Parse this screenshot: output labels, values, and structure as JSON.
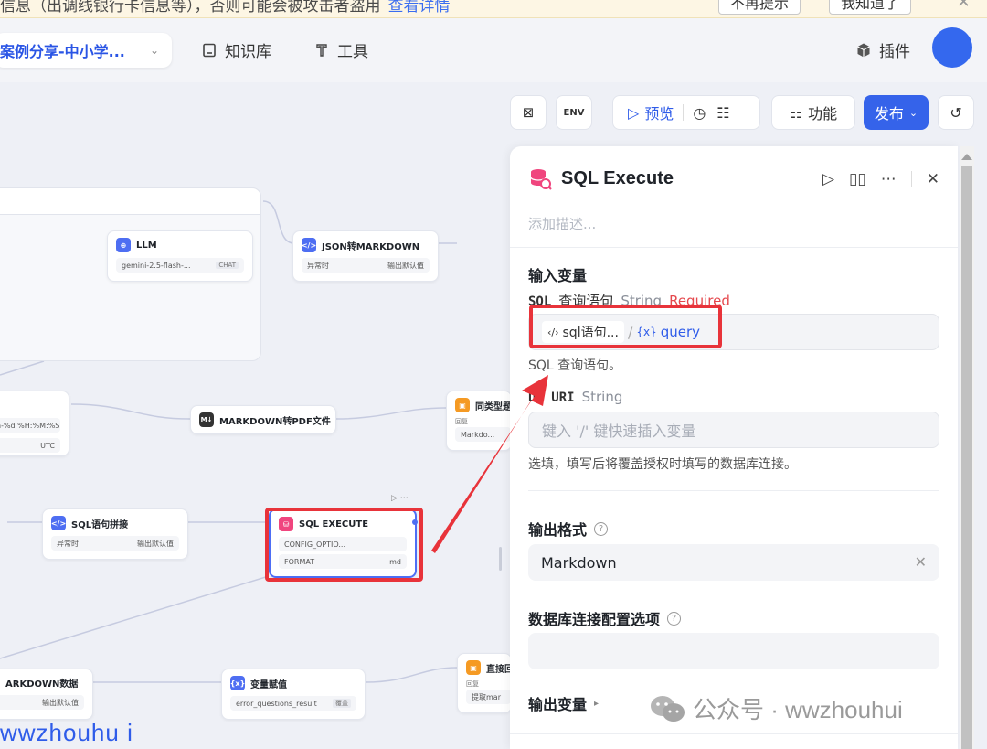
{
  "notice": {
    "text": "信息（出调线银行卡信息等），否则可能会被攻击者盗用",
    "link": "查看详情",
    "btn_nomore": "不再提示",
    "btn_ok": "我知道了",
    "close": "✕"
  },
  "nav": {
    "app_name": "案例分享-中小学...",
    "knowledge": "知识库",
    "tools": "工具",
    "plugins": "插件"
  },
  "toolbar": {
    "preview": "预览",
    "features": "功能",
    "publish": "发布"
  },
  "nodes": {
    "llm": {
      "title": "LLM",
      "model": "gemini-2.5-flash-...",
      "tag": "CHAT"
    },
    "json_md": {
      "title": "JSON转MARKDOWN",
      "label_left": "异常时",
      "label_right": "输出默认值"
    },
    "time": {
      "format": "n-%d %H:%M:%S",
      "tz": "UTC"
    },
    "md_pdf": {
      "title": "MARKDOWN转PDF文件",
      "badge": "M↓"
    },
    "similar": {
      "title": "同类型题目",
      "sub": "回复",
      "row": "Markdo..."
    },
    "sql_concat": {
      "title": "SQL语句拼接",
      "label_left": "异常时",
      "label_right": "输出默认值"
    },
    "sql_exec": {
      "title": "SQL EXECUTE",
      "row1": "CONFIG_OPTIO...",
      "row2_left": "FORMAT",
      "row2_right": "md"
    },
    "md_data": {
      "title": "ARKDOWN数据",
      "label_right": "输出默认值"
    },
    "assign": {
      "title": "变量赋值",
      "row": "error_questions_result",
      "tag": "覆盖"
    },
    "direct_reply": {
      "title": "直接回复",
      "sub": "回复",
      "row": "提取mar"
    }
  },
  "panel": {
    "title": "SQL Execute",
    "desc_placeholder": "添加描述...",
    "input_section": "输入变量",
    "sql_var": {
      "code": "SQL",
      "name": "查询语句",
      "type": "String",
      "required": "Required"
    },
    "sql_chip": "sql语句...",
    "sql_chip_sep": "/",
    "sql_var_ref": "query",
    "sql_hint": "SQL 查询语句。",
    "uri_var": {
      "code": "DB URI",
      "type": "String"
    },
    "uri_placeholder": "键入 '/' 键快速插入变量",
    "uri_hint": "选填，填写后将覆盖授权时填写的数据库连接。",
    "format_section": "输出格式",
    "format_value": "Markdown",
    "conn_section": "数据库连接配置选项",
    "output_section": "输出变量"
  },
  "watermark": {
    "text": "公众号 · wwzhouhui",
    "left_text": "wwzhouhu i"
  },
  "colors": {
    "accent": "#3563ea",
    "required": "#e5484d",
    "highlight": "#e8333a"
  }
}
